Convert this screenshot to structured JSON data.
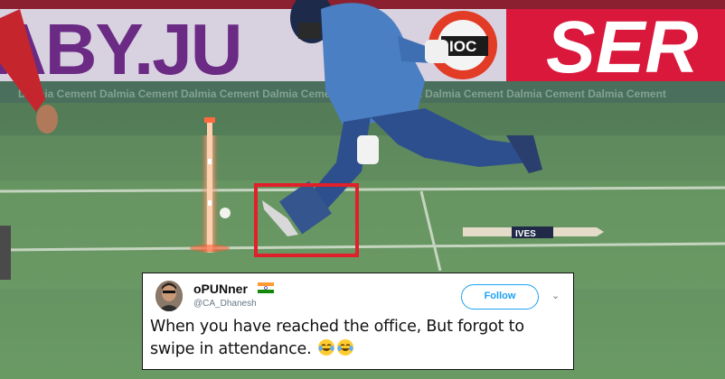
{
  "hoardings": {
    "left_text": "ABY.JU",
    "right_text": "SER",
    "ioc_text": "IOC",
    "boundary_text": "Dalmia Cement Dalmia Cement Dalmia Cement Dalmia Cement Dalmia Cement Dalmia Cement Dalmia Cement Dalmia Cement",
    "bat_label": "IVES"
  },
  "tweet": {
    "display_name": "oPUNner",
    "handle": "@CA_Dhanesh",
    "follow_label": "Follow",
    "text": "When you have reached the office, But forgot to swipe in attendance.",
    "emoji_icon": "face-with-tears-of-joy-icon",
    "emoji_count": 2
  },
  "colors": {
    "twitter_blue": "#1da1f2",
    "highlight_box": "#e0202a",
    "pitch_green": "#5f8f5c"
  }
}
